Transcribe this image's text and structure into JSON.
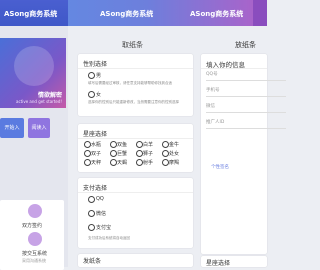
{
  "app": {
    "title_left": "ASong商务系统",
    "title_center": "ASong商务系统",
    "title_right": "ASong商务系统"
  },
  "hero": {
    "heading": "情欲解密",
    "sub": "active and get started!",
    "btn1": "开始入",
    "btn2": "阅读入"
  },
  "mini_cards": [
    {
      "title": "双方签约",
      "sub": "签约后才能开始正式"
    },
    {
      "title": "按交互系统",
      "sub": "采用沟通系统"
    }
  ],
  "middle": {
    "header": "取纸条",
    "gender": {
      "title": "性别选择",
      "options": [
        {
          "label": "男",
          "desc": "填写后需要经过审核，请任意支持能够帮助你找到合适"
        },
        {
          "label": "女",
          "desc": "选择你的性别后只能重新修改，当然需要注意你的性别选择"
        }
      ]
    },
    "zodiac": {
      "title": "星座选择",
      "options": [
        [
          "水瓶",
          "双鱼",
          "白羊",
          "金牛"
        ],
        [
          "双子",
          "巨蟹",
          "狮子",
          "处女"
        ],
        [
          "天秤",
          "天蝎",
          "射手",
          "摩羯"
        ]
      ]
    },
    "pay": {
      "title": "支付选择",
      "options": [
        "QQ",
        "微信",
        "支付宝"
      ],
      "desc": "支付成功后系统将自动返回"
    },
    "footer": "发纸条"
  },
  "right": {
    "header": "放纸条",
    "form_title": "填入你的信息",
    "fields": [
      "QQ号",
      "手机号",
      "微信",
      "推广人ID"
    ],
    "button": "个性签名",
    "zodiac_title": "星座选择"
  }
}
